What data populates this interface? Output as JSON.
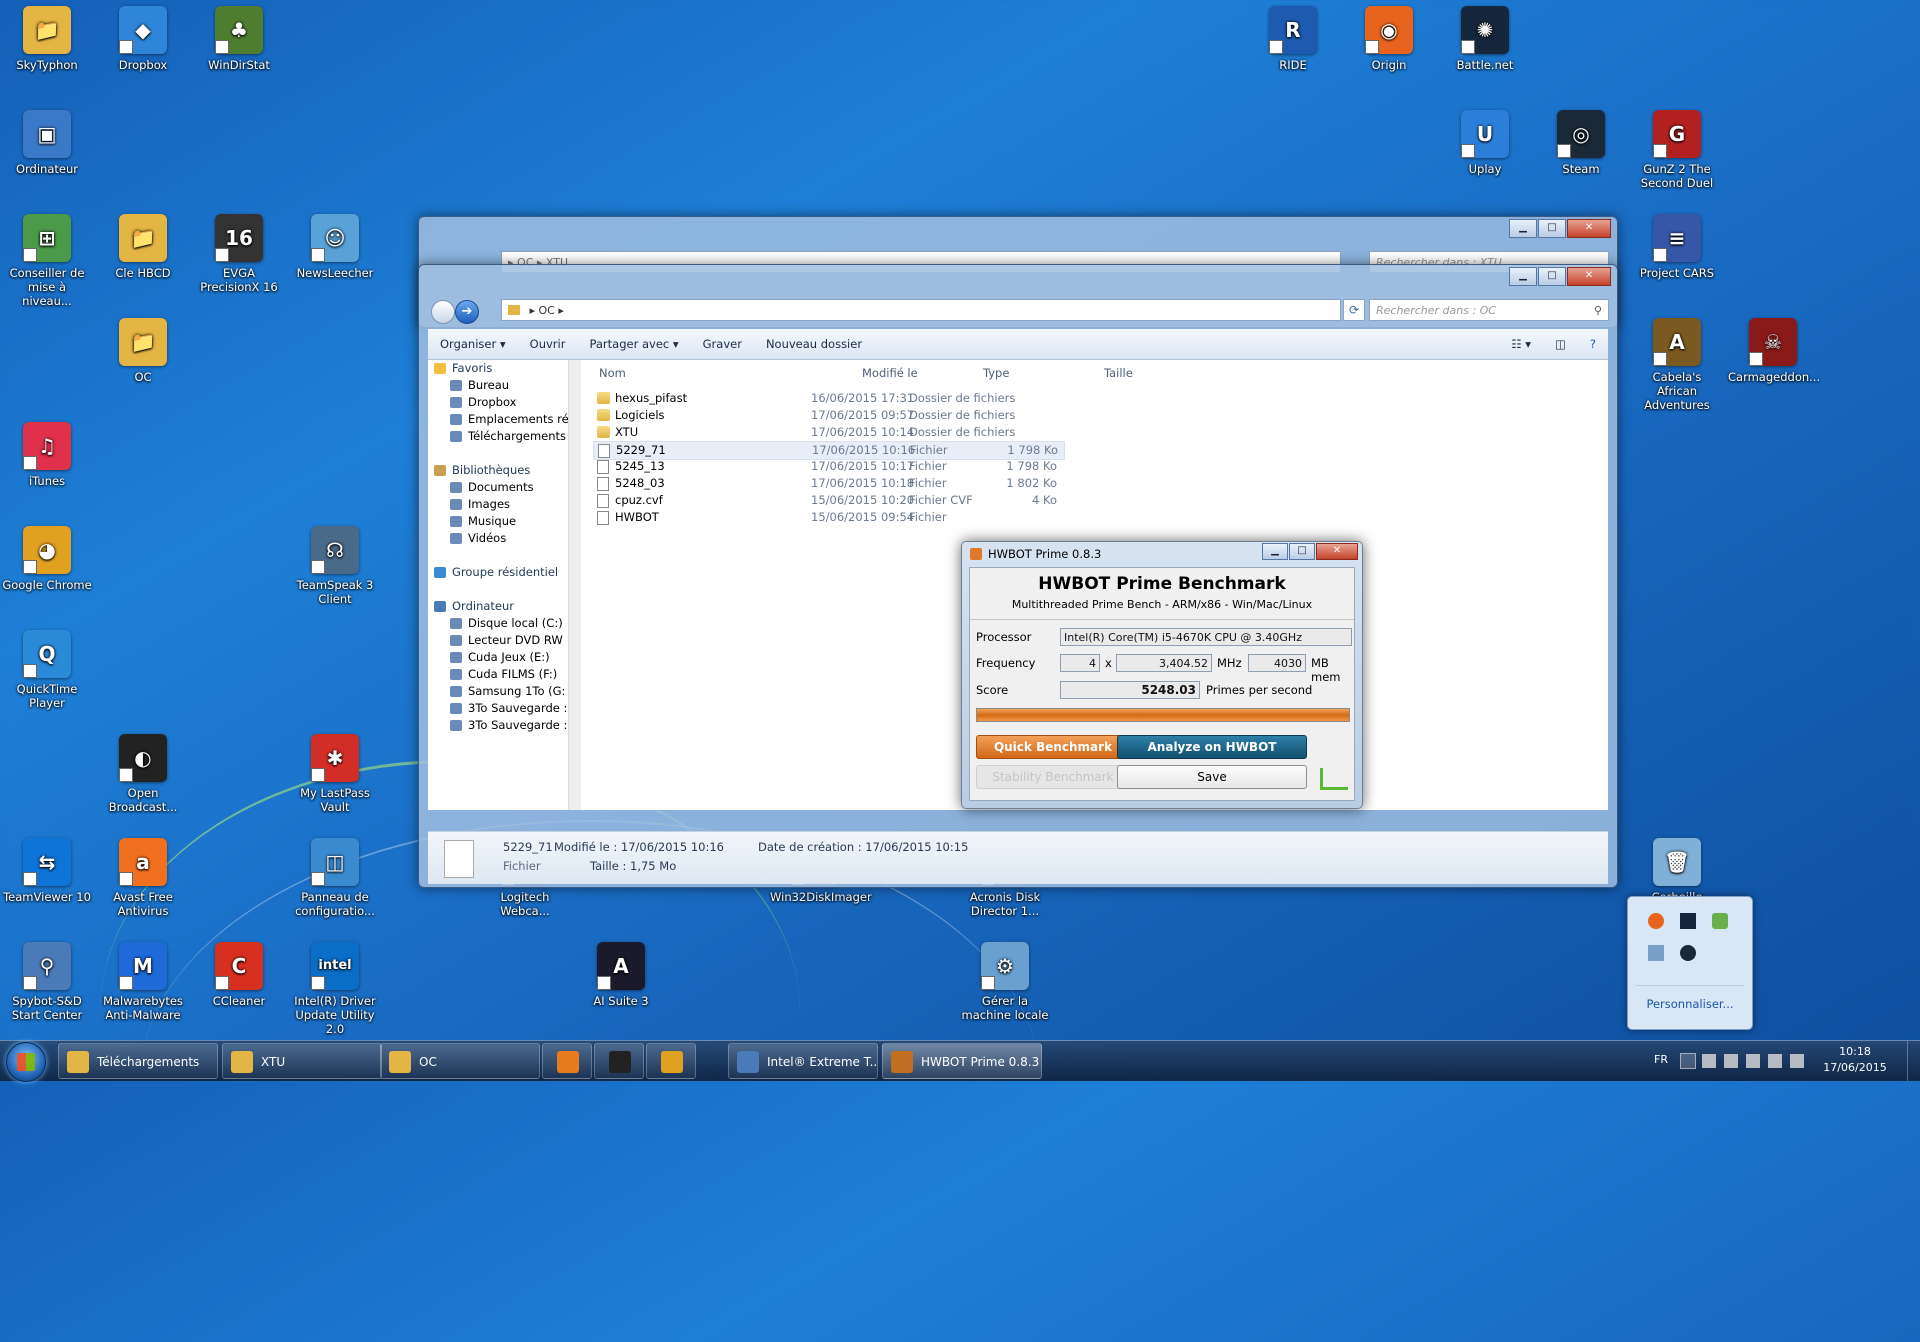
{
  "desktop": {
    "icons": [
      {
        "label": "SkyTyphon",
        "color": "#e2b544",
        "glyph": "📁"
      },
      {
        "label": "Dropbox",
        "color": "#2f86d9",
        "glyph": "◆"
      },
      {
        "label": "WinDirStat",
        "color": "#4f7d30",
        "glyph": "♣"
      },
      {
        "label": "RIDE",
        "color": "#1e5bb0",
        "glyph": "R"
      },
      {
        "label": "Origin",
        "color": "#e8641e",
        "glyph": "◉"
      },
      {
        "label": "Battle.net",
        "color": "#16263d",
        "glyph": "✺"
      },
      {
        "label": "Ordinateur",
        "color": "#3a78c8",
        "glyph": "▣"
      },
      {
        "label": "Uplay",
        "color": "#2b7fd8",
        "glyph": "U"
      },
      {
        "label": "Steam",
        "color": "#1b2838",
        "glyph": "◎"
      },
      {
        "label": "GunZ 2 The Second Duel",
        "color": "#b32020",
        "glyph": "G"
      },
      {
        "label": "Conseiller de mise à niveau...",
        "color": "#4a9a4a",
        "glyph": "⊞"
      },
      {
        "label": "Cle HBCD",
        "color": "#e2b544",
        "glyph": "📁"
      },
      {
        "label": "EVGA PrecisionX 16",
        "color": "#333333",
        "glyph": "16"
      },
      {
        "label": "NewsLeecher",
        "color": "#58a2d8",
        "glyph": "☺"
      },
      {
        "label": "Project CARS",
        "color": "#3656a8",
        "glyph": "≡"
      },
      {
        "label": "OC",
        "color": "#e2b544",
        "glyph": "📁"
      },
      {
        "label": "Cabela's African Adventures",
        "color": "#7a5a20",
        "glyph": "A"
      },
      {
        "label": "Carmageddon...",
        "color": "#8a1a1a",
        "glyph": "☠"
      },
      {
        "label": "iTunes",
        "color": "#e0304c",
        "glyph": "♫"
      },
      {
        "label": "Google Chrome",
        "color": "#e0a020",
        "glyph": "◕"
      },
      {
        "label": "TeamSpeak 3 Client",
        "color": "#4a6a8a",
        "glyph": "☊"
      },
      {
        "label": "QuickTime Player",
        "color": "#2a8ad8",
        "glyph": "Q"
      },
      {
        "label": "Open Broadcast...",
        "color": "#222222",
        "glyph": "◐"
      },
      {
        "label": "My LastPass Vault",
        "color": "#d32d27",
        "glyph": "✱"
      },
      {
        "label": "TeamViewer 10",
        "color": "#0e74d8",
        "glyph": "⇆"
      },
      {
        "label": "Avast Free Antivirus",
        "color": "#f07020",
        "glyph": "a"
      },
      {
        "label": "Panneau de configuratio...",
        "color": "#3a8ad0",
        "glyph": "◫"
      },
      {
        "label": "Logitech Webca...",
        "color": "#2a4a8a",
        "glyph": "◉"
      },
      {
        "label": "Win32DiskImager",
        "color": "#5a8ab0",
        "glyph": "▤"
      },
      {
        "label": "Acronis Disk Director 1...",
        "color": "#3a6aa0",
        "glyph": "◒"
      },
      {
        "label": "Corbeille",
        "color": "#7fb0d8",
        "glyph": "🗑"
      },
      {
        "label": "Spybot-S&D Start Center",
        "color": "#4a7ab8",
        "glyph": "⚲"
      },
      {
        "label": "Malwarebytes Anti-Malware",
        "color": "#1e6ad8",
        "glyph": "M"
      },
      {
        "label": "CCleaner",
        "color": "#d83020",
        "glyph": "C"
      },
      {
        "label": "Intel(R) Driver Update Utility 2.0",
        "color": "#0a6ec8",
        "glyph": "intel"
      },
      {
        "label": "AI Suite 3",
        "color": "#1a1a2a",
        "glyph": "A"
      },
      {
        "label": "Gérer la machine locale",
        "color": "#6aa0d0",
        "glyph": "⚙"
      }
    ]
  },
  "explorer_back": {
    "path": [
      "OC",
      "XTU"
    ],
    "search_placeholder": "Rechercher dans : XTU"
  },
  "explorer": {
    "path": [
      "OC"
    ],
    "search_placeholder": "Rechercher dans : OC",
    "toolbar": [
      "Organiser ▾",
      "Ouvrir",
      "Partager avec ▾",
      "Graver",
      "Nouveau dossier"
    ],
    "nav": [
      {
        "label": "Favoris",
        "group": true
      },
      {
        "label": "Bureau",
        "group": false
      },
      {
        "label": "Dropbox",
        "group": false
      },
      {
        "label": "Emplacements ré",
        "group": false
      },
      {
        "label": "Téléchargements",
        "group": false
      },
      {
        "label": "",
        "group": false
      },
      {
        "label": "Bibliothèques",
        "group": true
      },
      {
        "label": "Documents",
        "group": false
      },
      {
        "label": "Images",
        "group": false
      },
      {
        "label": "Musique",
        "group": false
      },
      {
        "label": "Vidéos",
        "group": false
      },
      {
        "label": "",
        "group": false
      },
      {
        "label": "Groupe résidentiel",
        "group": true
      },
      {
        "label": "",
        "group": false
      },
      {
        "label": "Ordinateur",
        "group": true
      },
      {
        "label": "Disque local (C:)",
        "group": false
      },
      {
        "label": "Lecteur DVD RW",
        "group": false
      },
      {
        "label": "Cuda Jeux (E:)",
        "group": false
      },
      {
        "label": "Cuda FILMS (F:)",
        "group": false
      },
      {
        "label": "Samsung 1To (G:",
        "group": false
      },
      {
        "label": "3To Sauvegarde :",
        "group": false
      },
      {
        "label": "3To Sauvegarde :",
        "group": false
      }
    ],
    "columns": {
      "name": "Nom",
      "modified": "Modifié le",
      "type": "Type",
      "size": "Taille"
    },
    "files": [
      {
        "name": "hexus_pifast",
        "modified": "16/06/2015 17:31",
        "type": "Dossier de fichiers",
        "size": "",
        "folder": true
      },
      {
        "name": "Logiciels",
        "modified": "17/06/2015 09:57",
        "type": "Dossier de fichiers",
        "size": "",
        "folder": true
      },
      {
        "name": "XTU",
        "modified": "17/06/2015 10:14",
        "type": "Dossier de fichiers",
        "size": "",
        "folder": true
      },
      {
        "name": "5229_71",
        "modified": "17/06/2015 10:16",
        "type": "Fichier",
        "size": "1 798 Ko",
        "folder": false,
        "selected": true
      },
      {
        "name": "5245_13",
        "modified": "17/06/2015 10:17",
        "type": "Fichier",
        "size": "1 798 Ko",
        "folder": false
      },
      {
        "name": "5248_03",
        "modified": "17/06/2015 10:18",
        "type": "Fichier",
        "size": "1 802 Ko",
        "folder": false
      },
      {
        "name": "cpuz.cvf",
        "modified": "15/06/2015 10:20",
        "type": "Fichier CVF",
        "size": "4 Ko",
        "folder": false
      },
      {
        "name": "HWBOT",
        "modified": "15/06/2015 09:54",
        "type": "Fichier",
        "size": "",
        "folder": false
      }
    ],
    "details": {
      "name": "5229_71",
      "type": "Fichier",
      "modified": "Modifié le : 17/06/2015 10:16",
      "created": "Date de création : 17/06/2015 10:15",
      "size": "Taille : 1,75 Mo"
    }
  },
  "hwbot": {
    "window_title": "HWBOT Prime 0.8.3",
    "title": "HWBOT Prime Benchmark",
    "subtitle": "Multithreaded Prime Bench - ARM/x86 - Win/Mac/Linux",
    "processor_label": "Processor",
    "processor": "Intel(R) Core(TM) i5-4670K CPU @ 3.40GHz",
    "frequency_label": "Frequency",
    "cores": "4",
    "x": "x",
    "mhz": "3,404.52",
    "mhz_unit": "MHz",
    "mem": "4030",
    "mem_unit": "MB mem",
    "score_label": "Score",
    "score": "5248.03",
    "score_unit": "Primes per second",
    "progress": 1.0,
    "quick": "Quick Benchmark",
    "analyze": "Analyze on HWBOT",
    "stability": "Stability Benchmark",
    "save": "Save"
  },
  "tray_popup": {
    "customize": "Personnaliser..."
  },
  "taskbar": {
    "items": [
      {
        "label": "Téléchargements",
        "color": "#e2b544"
      },
      {
        "label": "XTU",
        "color": "#e2b544"
      },
      {
        "label": "OC",
        "color": "#e2b544"
      },
      {
        "label": "",
        "color": "#e87a20"
      },
      {
        "label": "",
        "color": "#222222"
      },
      {
        "label": "",
        "color": "#e0a020"
      },
      {
        "label": "Intel® Extreme T...",
        "color": "#4a7ab8"
      },
      {
        "label": "HWBOT Prime 0.8.3",
        "color": "#c07020"
      }
    ],
    "lang": "FR",
    "time": "10:18",
    "date": "17/06/2015"
  }
}
